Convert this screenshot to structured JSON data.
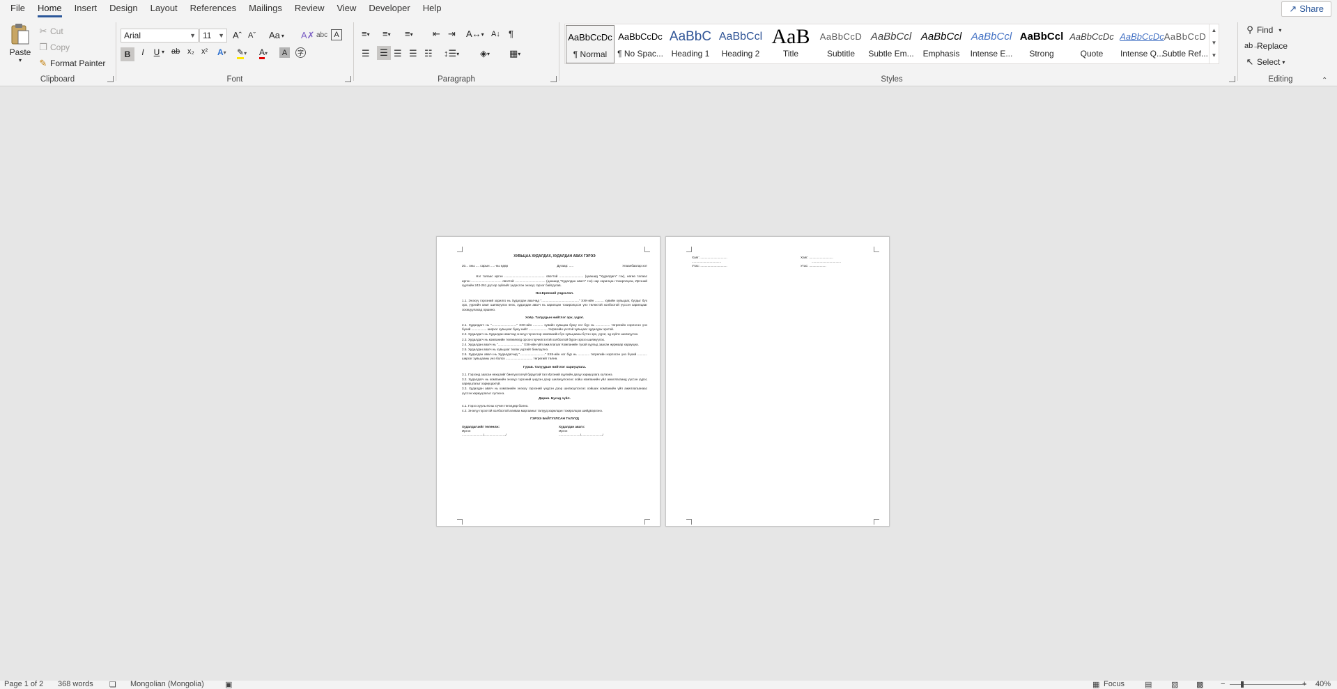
{
  "menu": {
    "tabs": [
      "File",
      "Home",
      "Insert",
      "Design",
      "Layout",
      "References",
      "Mailings",
      "Review",
      "View",
      "Developer",
      "Help"
    ],
    "active": "Home",
    "share": "Share"
  },
  "clipboard": {
    "label": "Clipboard",
    "paste": "Paste",
    "cut": "Cut",
    "copy": "Copy",
    "format_painter": "Format Painter"
  },
  "font": {
    "label": "Font",
    "family": "Arial",
    "size": "11",
    "change_case": "Aa"
  },
  "paragraph": {
    "label": "Paragraph"
  },
  "styles": {
    "label": "Styles",
    "items": [
      {
        "preview": "AaBbCcDc",
        "name": "¶ Normal"
      },
      {
        "preview": "AaBbCcDc",
        "name": "¶ No Spac..."
      },
      {
        "preview": "AaBbC",
        "name": "Heading 1"
      },
      {
        "preview": "AaBbCcl",
        "name": "Heading 2"
      },
      {
        "preview": "AaB",
        "name": "Title"
      },
      {
        "preview": "AaBbCcD",
        "name": "Subtitle"
      },
      {
        "preview": "AaBbCcl",
        "name": "Subtle Em..."
      },
      {
        "preview": "AaBbCcl",
        "name": "Emphasis"
      },
      {
        "preview": "AaBbCcl",
        "name": "Intense E..."
      },
      {
        "preview": "AaBbCcl",
        "name": "Strong"
      },
      {
        "preview": "AaBbCcDc",
        "name": "Quote"
      },
      {
        "preview": "AaBbCcDc",
        "name": "Intense Q..."
      },
      {
        "preview": "AaBbCcD",
        "name": "Subtle Ref..."
      }
    ]
  },
  "editing": {
    "label": "Editing",
    "find": "Find",
    "replace": "Replace",
    "select": "Select"
  },
  "page1": {
    "title": "ХУВЬЦАА ХУДАЛДАХ, ХУДАЛДАН АВАХ ГЭРЭЭ",
    "date_line": "20... оны .... сарын .....-ны өдөр",
    "contract_no": "Дугаар: .....",
    "city": "Улаанбаатар хот",
    "intro": "Нэг талаас иргэн ............................................. овогтой ........................... (цаашид \"Худалдагч\" гэх), нөгөө талаас иргэн .................................. овогтой .................................. (цаашид \"Худалдан авагч\" гэх) нар харилцан тохиролцож, Иргэний хуулийн 243-261 дүгээр зүйлийг үндэслэн энэхүү гэрээг байгуулав.",
    "h1": "Нэг.Ерөнхий үндэслэл.",
    "p11": "1.1.    Энэхүү гэрээний зорилго нь Худалдан авагчид \"..........................................\" ХХК-ийн .......... хувийн хувьцааг, бүгдыг бүх эрх, үүргийн хамт шилжүүлэх өгөх, худалдан авагч нь харилцан тохиролцсон үнэ төлөхтэй холбоотой үүссэн харилцааг зохицуулахад оршино.",
    "h2": "Хоёр. Талуудын нийтлэг эрх, үүрэг.",
    "p21": "2.1. Худалдагч нь \"............................\" ХХК-ийн ........... хувийн хувьцаа буюу нэг бүр нь ................ төгрөгийн нэрлэсэн үнэ бүхий ................. ширхэг хувьцааг буюу нийт ..................... төгрөгийн үнэтэй хувьцааг худалдах эрхтэй.",
    "p22": "2.2. Худалдагч нь Худалдан авагчид энэхүү гэрээгээр компанийн бүх хувьцааны бүтэн эрх, үүрэг, эд зүйлс шилжүүлэх.",
    "p23": "2.3. Худалдагч нь компанийн төлөөлөлд орсон гэрчилгээтэй холбоотой бүрэн эрхээ шилжүүлэх.",
    "p24": "2.4. Худалдан авагч нь \"...........................\" ХХК-ийн үйл ажиллагааг Компанийн тухай хуульд заасан журмаар хариуцна.",
    "p25": "2.5. Худалдан авагч нь хувьцааг төлөх үүргийг биелүүлнэ.",
    "p26": "2.6. Худалдан авагч нь Худалдагчид \"............................\" ХХК-ийн нэг бүр нь ............. төгрөгийн нэрлэсэн үнэ бүхий ........... ширхэг хувьцааны үнэ болох .............................. төгрөгийг төлнө.",
    "h3": "Гурав. Талуудын нийтлэг хариуцлага.",
    "p31": "3.1. Гэрээнд заасан нөхцлийг биелүүлээгүй буруутай тал Иргэний хуулийн дагуу хариуцлага хүлээнэ.",
    "p32": "3.2. Худалдагч нь компанийн энэхүү гэрээний үндсэн дээр шилжүүлснээс хойш компанийн үйл ажиллагаанд үүссэн үүрэг, хариуцлагыг хариуцахгүй.",
    "p33": "3.3. Худалдан авагч нь компанийн энэхүү гэрээний үндсэн дээр шилжүүлснээс хойших компанийн үйл ажиллагаанаас үүссэн хариуцлагыг хүлээнэ.",
    "h4": "Дөрөв. Бусад зүйл.",
    "p41": "4.1. Гэрээ хууль ёсны хүчин төгөлдөр болно.",
    "p42": "4.2. Энэхүү гэрээтэй холбоотой аливаа маргааныг талууд харилцан тохиролцож шийдвэрлэнэ.",
    "sign_title": "ГЭРЭЭ БАЙГУУЛСАН ТАЛУУД",
    "seller": "Худалдагчийг төлөөлж:",
    "buyer": "Худалдан авагч:",
    "citizen": "Иргэн",
    "sign_line": "......................../......................../"
  },
  "page2": {
    "left": [
      "Хаяг: ..............................",
      ".................................",
      "Утас: .............................."
    ],
    "right": [
      "Хаяг: ...........................",
      ".................................",
      "Утас: ..................."
    ]
  },
  "status": {
    "page": "Page 1 of 2",
    "words": "368 words",
    "language": "Mongolian (Mongolia)",
    "focus": "Focus",
    "zoom": "40%"
  }
}
